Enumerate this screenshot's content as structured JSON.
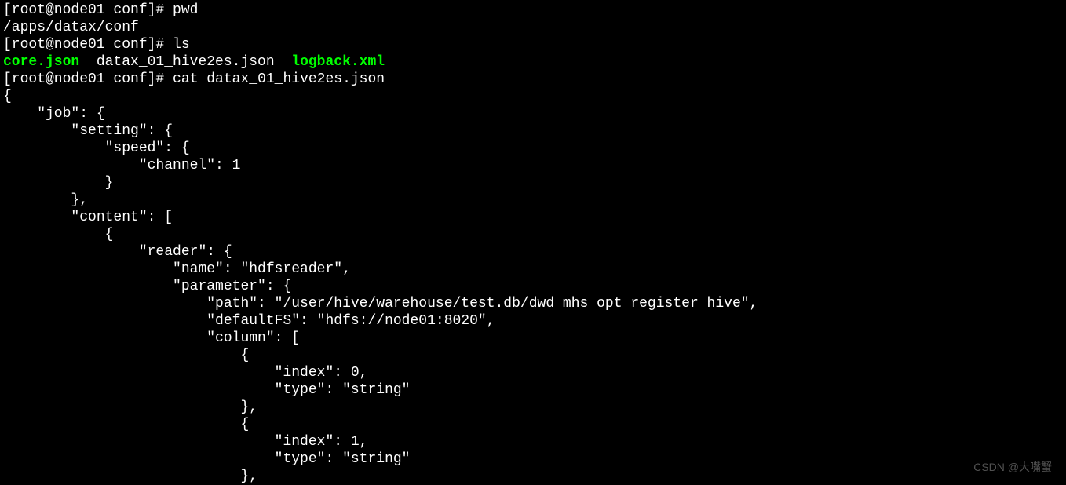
{
  "terminal": {
    "prompt1": "[root@node01 conf]# ",
    "cmd_pwd": "pwd",
    "pwd_output": "/apps/datax/conf",
    "prompt2": "[root@node01 conf]# ",
    "cmd_ls": "ls",
    "ls_file1": "core.json",
    "ls_file2": "  datax_01_hive2es.json  ",
    "ls_file3": "logback.xml",
    "prompt3": "[root@node01 conf]# ",
    "cmd_cat": "cat datax_01_hive2es.json",
    "json_lines": {
      "l01": "{",
      "l02": "    \"job\": {",
      "l03": "        \"setting\": {",
      "l04": "            \"speed\": {",
      "l05": "                \"channel\": 1",
      "l06": "            }",
      "l07": "        },",
      "l08": "        \"content\": [",
      "l09": "            {",
      "l10": "                \"reader\": {",
      "l11": "                    \"name\": \"hdfsreader\",",
      "l12": "                    \"parameter\": {",
      "l13": "                        \"path\": \"/user/hive/warehouse/test.db/dwd_mhs_opt_register_hive\",",
      "l14": "                        \"defaultFS\": \"hdfs://node01:8020\",",
      "l15": "                        \"column\": [",
      "l16": "                            {",
      "l17": "                                \"index\": 0,",
      "l18": "                                \"type\": \"string\"",
      "l19": "                            },",
      "l20": "                            {",
      "l21": "                                \"index\": 1,",
      "l22": "                                \"type\": \"string\"",
      "l23": "                            },"
    }
  },
  "watermark": "CSDN @大嘴蟹"
}
